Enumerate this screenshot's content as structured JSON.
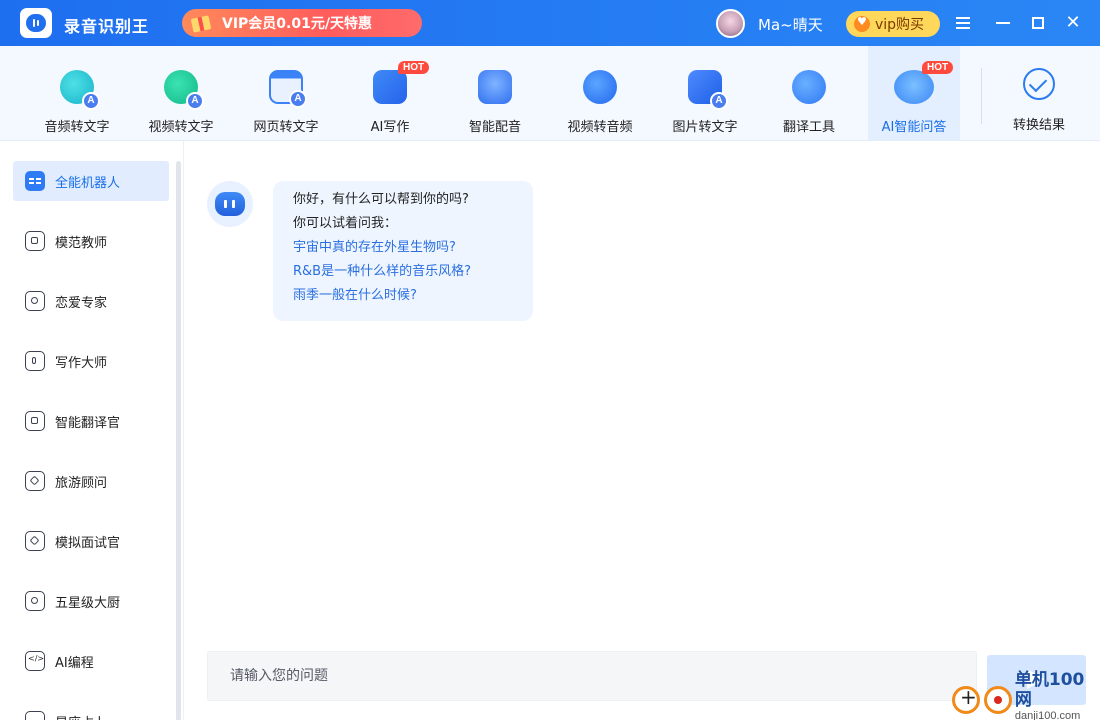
{
  "app": {
    "title": "录音识别王",
    "vip_banner": "VIP会员0.01元/天特惠",
    "username": "Ma~晴天",
    "vip_buy": "vip购买",
    "close_glyph": "✕"
  },
  "toolbar": {
    "items": [
      {
        "label": "音频转文字",
        "icon": "audio-to-text-icon"
      },
      {
        "label": "视频转文字",
        "icon": "video-to-text-icon"
      },
      {
        "label": "网页转文字",
        "icon": "webpage-to-text-icon"
      },
      {
        "label": "AI写作",
        "icon": "ai-writing-icon",
        "hot": "HOT"
      },
      {
        "label": "智能配音",
        "icon": "voice-dubbing-icon"
      },
      {
        "label": "视频转音频",
        "icon": "video-to-audio-icon"
      },
      {
        "label": "图片转文字",
        "icon": "image-to-text-icon"
      },
      {
        "label": "翻译工具",
        "icon": "translate-icon"
      },
      {
        "label": "AI智能问答",
        "icon": "ai-qa-icon",
        "hot": "HOT",
        "active": true
      }
    ],
    "result_label": "转换结果",
    "badge_letter": "A"
  },
  "sidebar": {
    "items": [
      {
        "label": "全能机器人",
        "active": true
      },
      {
        "label": "模范教师"
      },
      {
        "label": "恋爱专家"
      },
      {
        "label": "写作大师"
      },
      {
        "label": "智能翻译官"
      },
      {
        "label": "旅游顾问"
      },
      {
        "label": "模拟面试官"
      },
      {
        "label": "五星级大厨"
      },
      {
        "label": "AI编程"
      },
      {
        "label": "星座占卜"
      }
    ]
  },
  "chat": {
    "greeting": "你好，有什么可以帮到你的吗?",
    "prompt": "你可以试着问我：",
    "suggestions": [
      "宇宙中真的存在外星生物吗?",
      "R&B是一种什么样的音乐风格?",
      "雨季一般在什么时候?"
    ],
    "input_placeholder": "请输入您的问题",
    "input_value": ""
  },
  "watermark": {
    "name": "单机100网",
    "domain": "danji100.com"
  },
  "colors": {
    "brand_blue": "#1e6ff0",
    "active_text": "#1a6fe8",
    "hot_red": "#ff4a3d",
    "vip_gold": "#ffd75a"
  }
}
